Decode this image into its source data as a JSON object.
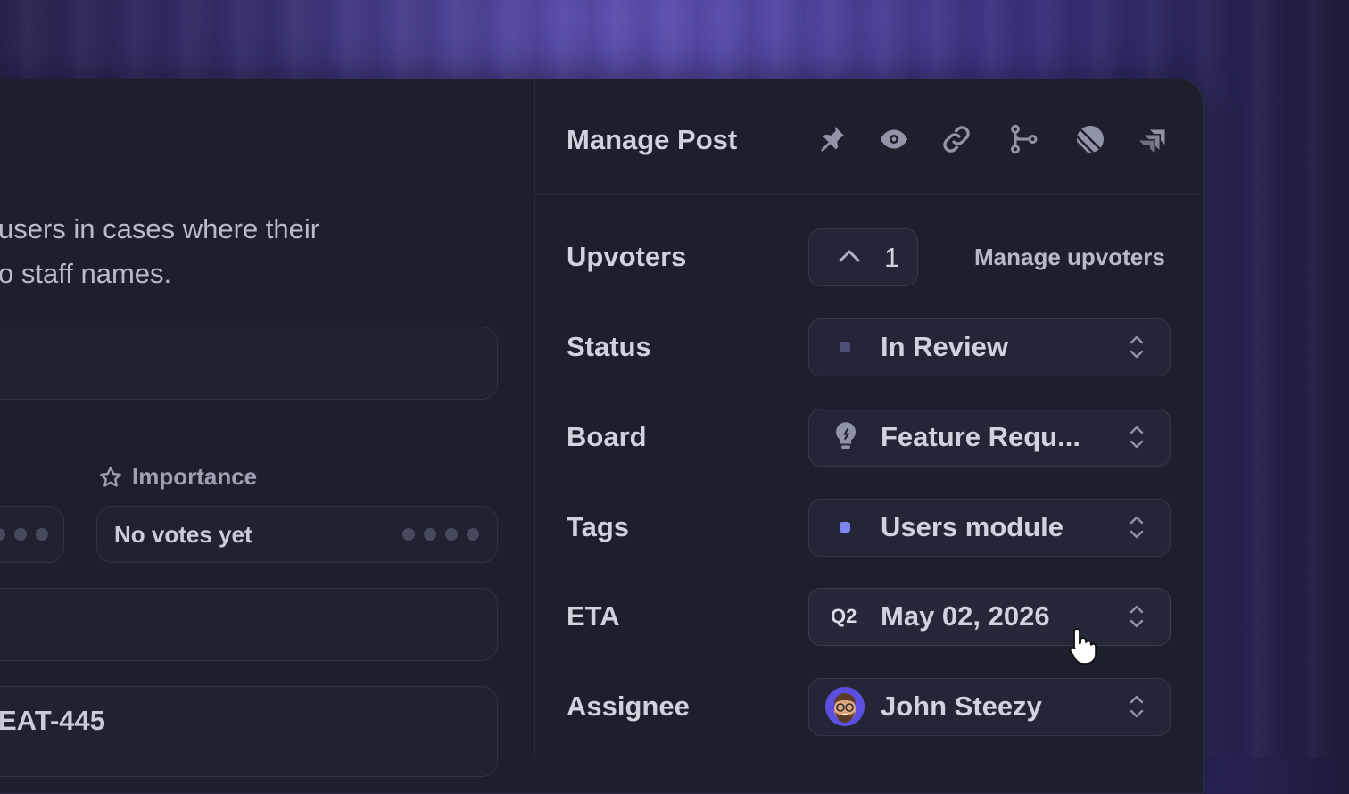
{
  "left": {
    "description_lines": [
      "users in cases where their",
      "o staff names."
    ],
    "importance_label": "Importance",
    "importance_value": "No votes yet",
    "issue_key": "EAT-445"
  },
  "panel": {
    "title": "Manage Post",
    "header_icons": [
      "pin-icon",
      "eye-icon",
      "link-icon",
      "git-branch-icon",
      "linear-icon",
      "jira-icon"
    ],
    "upvoters": {
      "label": "Upvoters",
      "count": "1",
      "manage_label": "Manage upvoters"
    },
    "status": {
      "label": "Status",
      "value": "In Review",
      "dot_color": "#4a5078"
    },
    "board": {
      "label": "Board",
      "value": "Feature Requ...",
      "icon": "lightbulb-icon"
    },
    "tags": {
      "label": "Tags",
      "value": "Users module",
      "dot_color": "#7d86f0"
    },
    "eta": {
      "label": "ETA",
      "quarter": "Q2",
      "value": "May 02, 2026"
    },
    "assignee": {
      "label": "Assignee",
      "value": "John Steezy",
      "avatar": "memoji-avatar"
    }
  }
}
